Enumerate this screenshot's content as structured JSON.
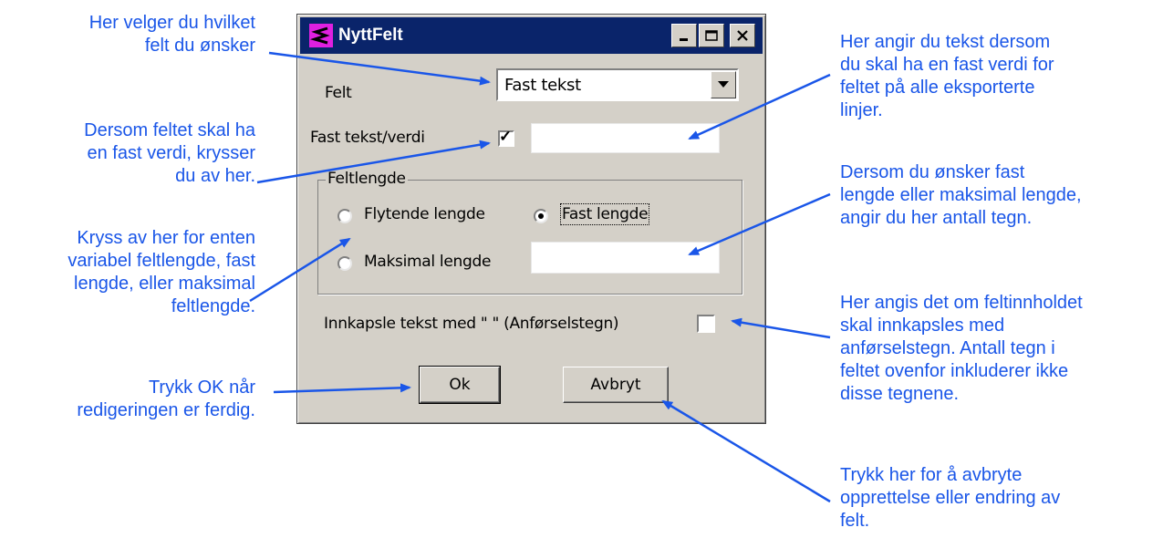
{
  "dialog": {
    "title": "NyttFelt",
    "felt_label": "Felt",
    "felt_value": "Fast tekst",
    "fast_tekst_label": "Fast tekst/verdi",
    "fast_tekst_checked": true,
    "fast_tekst_value": "",
    "group_label": "Feltlengde",
    "radio_flytende": "Flytende lengde",
    "radio_fast": "Fast lengde",
    "radio_maks": "Maksimal lengde",
    "selected_radio": "Fast lengde",
    "length_value": "",
    "innkapsle_label": "Innkapsle tekst med \" \" (Anførselstegn)",
    "innkapsle_checked": false,
    "ok_label": "Ok",
    "cancel_label": "Avbryt"
  },
  "annotations": {
    "velger_felt": "Her velger du hvilket\nfelt du ønsker",
    "fast_verdi_kryss": "Dersom feltet skal ha\nen fast verdi, krysser\ndu av her.",
    "kryss_lengde": "Kryss av her for enten\nvariabel feltlengde, fast\nlengde, eller maksimal\nfeltlengde.",
    "trykk_ok": "Trykk OK når\nredigeringen er ferdig.",
    "angir_tekst": "Her angir du tekst dersom\ndu skal ha en fast verdi for\nfeltet på alle eksporterte\nlinjer.",
    "antall_tegn": "Dersom du ønsker fast\nlengde eller maksimal lengde,\nangir du her antall tegn.",
    "innkapsles": "Her angis det om feltinnholdet\nskal innkapsles med\nanførselstegn. Antall tegn i\nfeltet ovenfor inkluderer ikke\ndisse tegnene.",
    "avbryte": "Trykk her for å avbryte\nopprettelse eller endring av\nfelt."
  },
  "colors": {
    "annotation": "#1a56e8",
    "titlebar": "#0a246a",
    "dialog_bg": "#d4d0c8"
  }
}
